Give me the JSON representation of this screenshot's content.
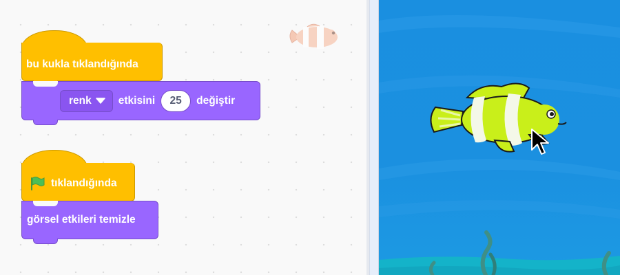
{
  "blocks": {
    "sprite_clicked_hat": "bu kukla tıklandığında",
    "change_effect": {
      "effect_option": "renk",
      "prefix": "etkisini",
      "value": "25",
      "suffix": "değiştir"
    },
    "flag_clicked_hat": "tıklandığında",
    "clear_effects": "görsel etkileri temizle"
  },
  "colors": {
    "events_block": "#ffbf00",
    "looks_block": "#9966ff",
    "stage_water": "#1a8fe0",
    "fish_body": "#c9ef1a"
  },
  "icons": {
    "green_flag": "green-flag-icon",
    "dropdown": "caret-down-icon",
    "cursor": "mouse-pointer-icon"
  }
}
